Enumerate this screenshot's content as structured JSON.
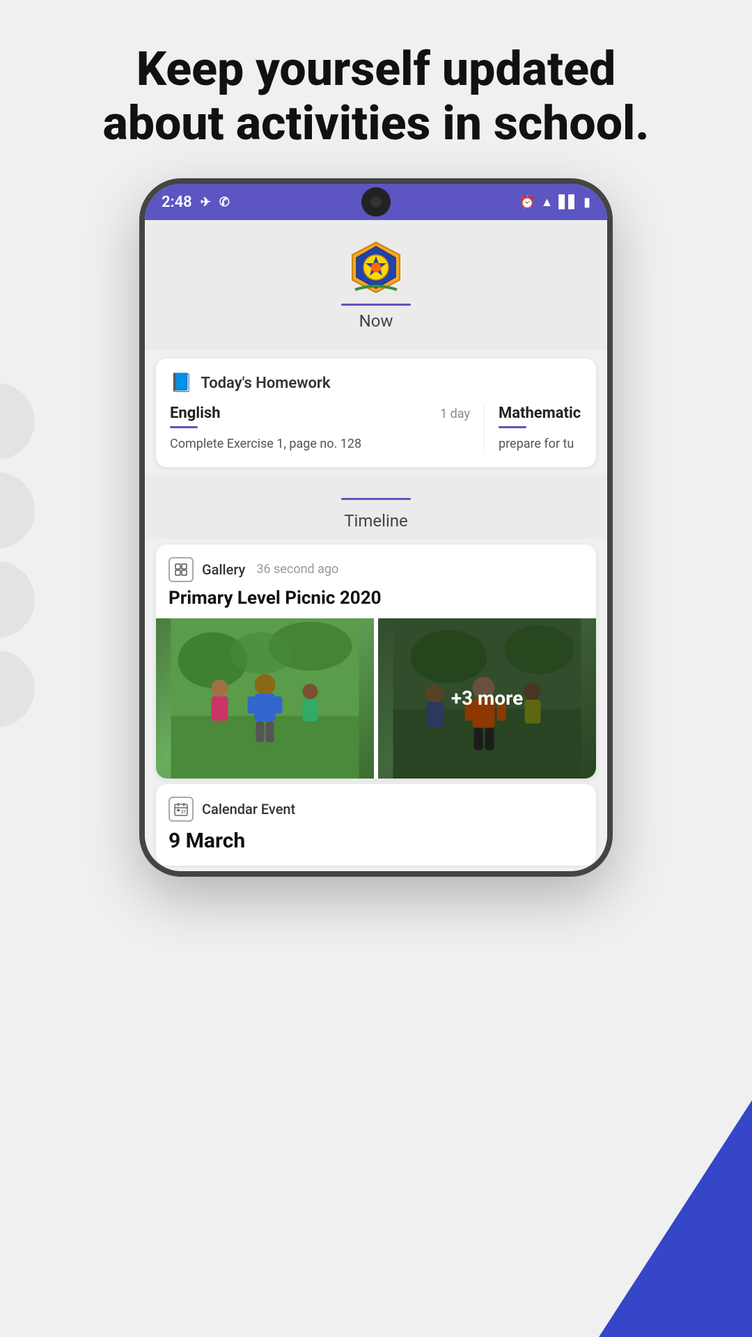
{
  "page": {
    "headline_line1": "Keep yourself updated",
    "headline_line2": "about activities in school."
  },
  "status_bar": {
    "time": "2:48",
    "icons_left": [
      "messages-icon",
      "whatsapp-icon"
    ],
    "icons_right": [
      "alarm-icon",
      "wifi-icon",
      "signal-icon",
      "battery-icon"
    ]
  },
  "school_section": {
    "tab_label": "Now"
  },
  "homework_card": {
    "icon": "📚",
    "title": "Today's Homework",
    "subjects": [
      {
        "name": "English",
        "due": "1 day",
        "description": "Complete Exercise 1, page no. 128"
      },
      {
        "name": "Mathematic",
        "due": "",
        "description": "prepare for tu"
      }
    ]
  },
  "timeline_section": {
    "tab_label": "Timeline"
  },
  "gallery_card": {
    "label": "Gallery",
    "time_ago": "36 second ago",
    "title": "Primary Level Picnic 2020",
    "extra_count": "+3 more"
  },
  "calendar_card": {
    "label": "Calendar Event",
    "date": "9 March"
  },
  "bg_circles": [
    "",
    "",
    "",
    ""
  ],
  "decorative": {
    "triangle_color": "#3547c8"
  }
}
